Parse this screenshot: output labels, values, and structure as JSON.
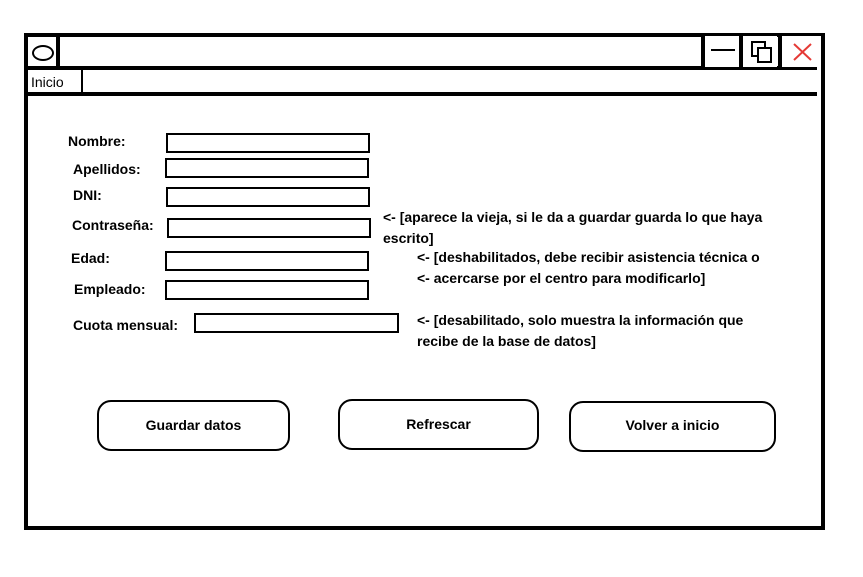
{
  "menu": {
    "inicio_label": "Inicio"
  },
  "form": {
    "nombre_label": "Nombre:",
    "apellidos_label": "Apellidos:",
    "dni_label": "DNI:",
    "contrasena_label": "Contraseña:",
    "edad_label": "Edad:",
    "empleado_label": "Empleado:",
    "cuota_label": "Cuota mensual:"
  },
  "notes": {
    "contrasena_line1": "<- [aparece la vieja, si le da a guardar guarda lo que haya",
    "contrasena_line2": "escrito]",
    "disabled_line1": "<- [deshabilitados, debe recibir asistencia técnica o",
    "disabled_line2": "<-   acercarse por el centro para modificarlo]",
    "cuota_line1": "<- [desabilitado, solo muestra la información que",
    "cuota_line2": "recibe de la base de datos]"
  },
  "buttons": {
    "guardar_label": "Guardar datos",
    "refrescar_label": "Refrescar",
    "volver_label": "Volver a inicio"
  },
  "colors": {
    "close_icon": "#e53935",
    "frame": "#000000"
  },
  "icons": {
    "window": "window-icon",
    "minimize": "minimize-icon",
    "maximize": "restore-icon",
    "close": "close-icon"
  }
}
